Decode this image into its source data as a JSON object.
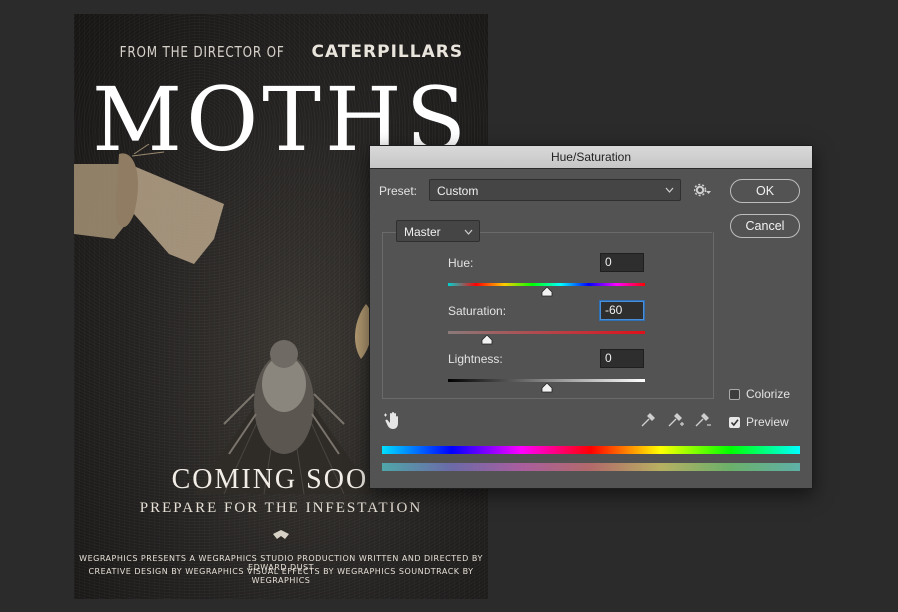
{
  "poster": {
    "director_prefix": "FROM THE DIRECTOR OF",
    "director_film": "CATERPILLARS",
    "title": "MOTHS",
    "coming_soon": "COMING SOON",
    "tagline": "PREPARE FOR THE INFESTATION",
    "credits_line1": "WEGRAPHICS PRESENTS A WEGRAPHICS STUDIO PRODUCTION WRITTEN AND DIRECTED BY EDWARD DUST",
    "credits_line2": "CREATIVE DESIGN BY WEGRAPHICS VISUAL EFFECTS BY WEGRAPHICS SOUNDTRACK BY WEGRAPHICS"
  },
  "dialog": {
    "title": "Hue/Saturation",
    "preset_label": "Preset:",
    "preset_value": "Custom",
    "channel_value": "Master",
    "ok_label": "OK",
    "cancel_label": "Cancel",
    "hue": {
      "label": "Hue:",
      "value": "0",
      "slider_fraction": 0.5
    },
    "saturation": {
      "label": "Saturation:",
      "value": "-60",
      "slider_fraction": 0.2
    },
    "lightness": {
      "label": "Lightness:",
      "value": "0",
      "slider_fraction": 0.5
    },
    "colorize": {
      "label": "Colorize",
      "checked": false
    },
    "preview": {
      "label": "Preview",
      "checked": true
    },
    "icons": [
      "settings-gear-icon",
      "hand-target-icon",
      "eyedropper-icon",
      "eyedropper-plus-icon",
      "eyedropper-minus-icon",
      "chevron-down-icon"
    ]
  }
}
